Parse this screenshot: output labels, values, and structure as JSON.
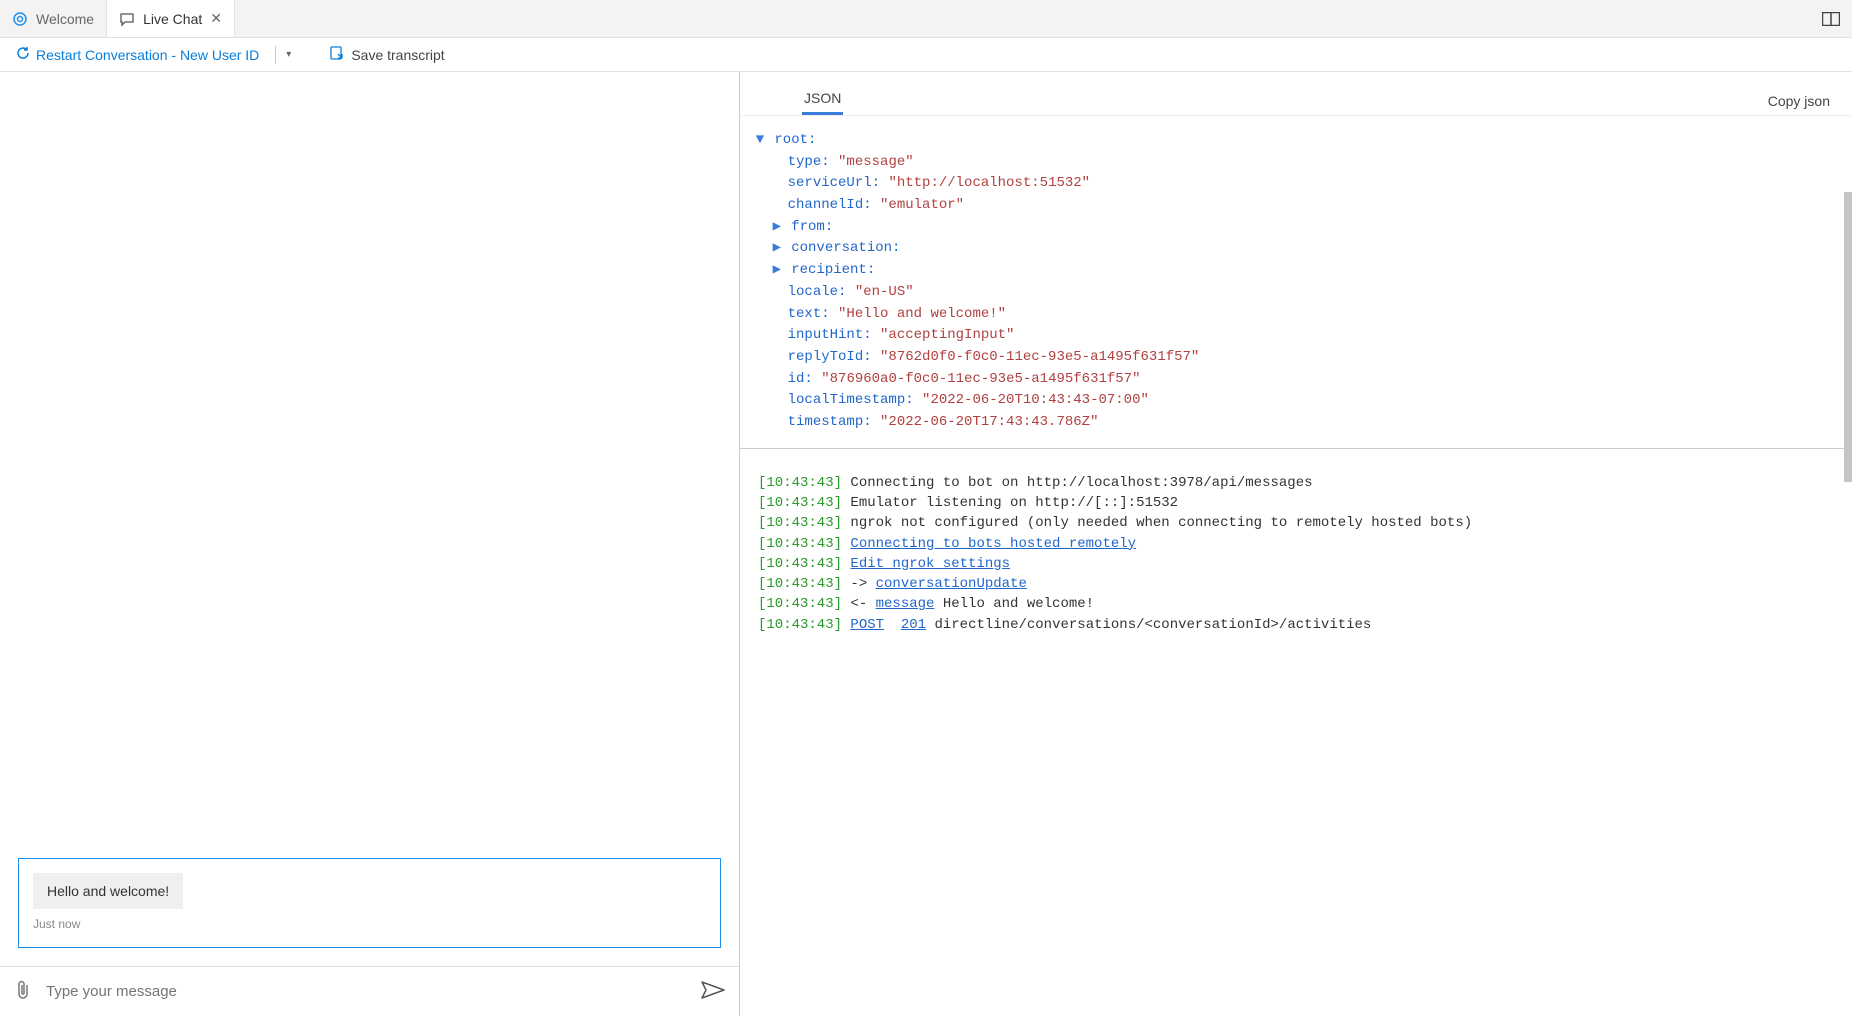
{
  "tabs": {
    "welcome": "Welcome",
    "livechat": "Live Chat"
  },
  "toolbar": {
    "restart": "Restart Conversation - New User ID",
    "save": "Save transcript"
  },
  "chat": {
    "bubble_text": "Hello and welcome!",
    "bubble_time": "Just now",
    "placeholder": "Type your message"
  },
  "json_panel": {
    "tab_label": "JSON",
    "copy_label": "Copy json",
    "root_label": "root:",
    "fields": {
      "type_k": "type:",
      "type_v": "\"message\"",
      "serviceUrl_k": "serviceUrl:",
      "serviceUrl_v": "\"http://localhost:51532\"",
      "channelId_k": "channelId:",
      "channelId_v": "\"emulator\"",
      "from_k": "from:",
      "conversation_k": "conversation:",
      "recipient_k": "recipient:",
      "locale_k": "locale:",
      "locale_v": "\"en-US\"",
      "text_k": "text:",
      "text_v": "\"Hello and welcome!\"",
      "inputHint_k": "inputHint:",
      "inputHint_v": "\"acceptingInput\"",
      "replyToId_k": "replyToId:",
      "replyToId_v": "\"8762d0f0-f0c0-11ec-93e5-a1495f631f57\"",
      "id_k": "id:",
      "id_v": "\"876960a0-f0c0-11ec-93e5-a1495f631f57\"",
      "localTimestamp_k": "localTimestamp:",
      "localTimestamp_v": "\"2022-06-20T10:43:43-07:00\"",
      "timestamp_k": "timestamp:",
      "timestamp_v": "\"2022-06-20T17:43:43.786Z\""
    }
  },
  "log": {
    "ts": "[10:43:43]",
    "l1": " Connecting to bot on http://localhost:3978/api/messages",
    "l2": " Emulator listening on http://[::]:51532",
    "l3": " ngrok not configured (only needed when connecting to remotely hosted bots)",
    "l4_link": "Connecting to bots hosted remotely",
    "l5_link": "Edit ngrok settings",
    "l6_arrow": " -> ",
    "l6_link": "conversationUpdate",
    "l7_arrow": " <- ",
    "l7_link": "message",
    "l7_tail": " Hello and welcome!",
    "l8_post": "POST",
    "l8_code": "201",
    "l8_tail": " directline/conversations/<conversationId>/activities"
  }
}
